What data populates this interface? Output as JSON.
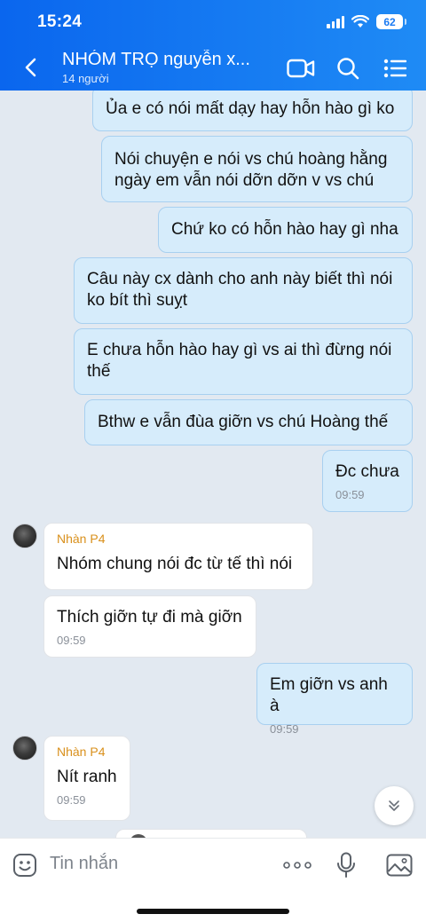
{
  "status_bar": {
    "time": "15:24",
    "battery": "62"
  },
  "header": {
    "title": "NHÓM TRỌ nguyễn x...",
    "subtitle": "14 người"
  },
  "messages": [
    {
      "dir": "out",
      "text": "Ủa e có nói mất dạy hay hỗn hào gì ko"
    },
    {
      "dir": "out",
      "text": "Nói chuyện e nói vs chú hoàng hằng ngày em vẫn nói dỡn dỡn v vs chú"
    },
    {
      "dir": "out",
      "text": "Chứ ko có hỗn hào hay gì nha"
    },
    {
      "dir": "out",
      "text": "Câu này cx dành cho anh này biết thì nói ko bít thì suỵt"
    },
    {
      "dir": "out",
      "text": "E chưa hỗn hào hay gì vs ai thì đừng nói thế"
    },
    {
      "dir": "out",
      "text": "Bthw e vẫn đùa giỡn vs chú Hoàng thế"
    },
    {
      "dir": "out",
      "text": "Đc chưa",
      "time": "09:59"
    },
    {
      "dir": "in",
      "sender": "Nhàn P4",
      "text": "Nhóm chung nói đc từ tế thì nói"
    },
    {
      "dir": "in",
      "text": "Thích giỡn tự đi mà giỡn",
      "time": "09:59"
    },
    {
      "dir": "out",
      "text": "Em giỡn vs anh à",
      "time": "09:59"
    },
    {
      "dir": "in",
      "sender": "Nhàn P4",
      "text": "Nít ranh",
      "time": "09:59"
    }
  ],
  "input": {
    "placeholder": "Tin nhắn"
  },
  "icons": {
    "back": "chevron-left-icon",
    "video": "video-camera-icon",
    "search": "search-icon",
    "menu": "list-menu-icon",
    "emoji": "emoji-icon",
    "more": "more-dots-icon",
    "mic": "microphone-icon",
    "image": "image-icon",
    "scroll": "double-chevron-down-icon"
  },
  "colors": {
    "header_start": "#0a66ee",
    "header_end": "#1f8bf5",
    "outgoing_bubble": "#d6ecfb",
    "sender_name": "#d9901c"
  }
}
